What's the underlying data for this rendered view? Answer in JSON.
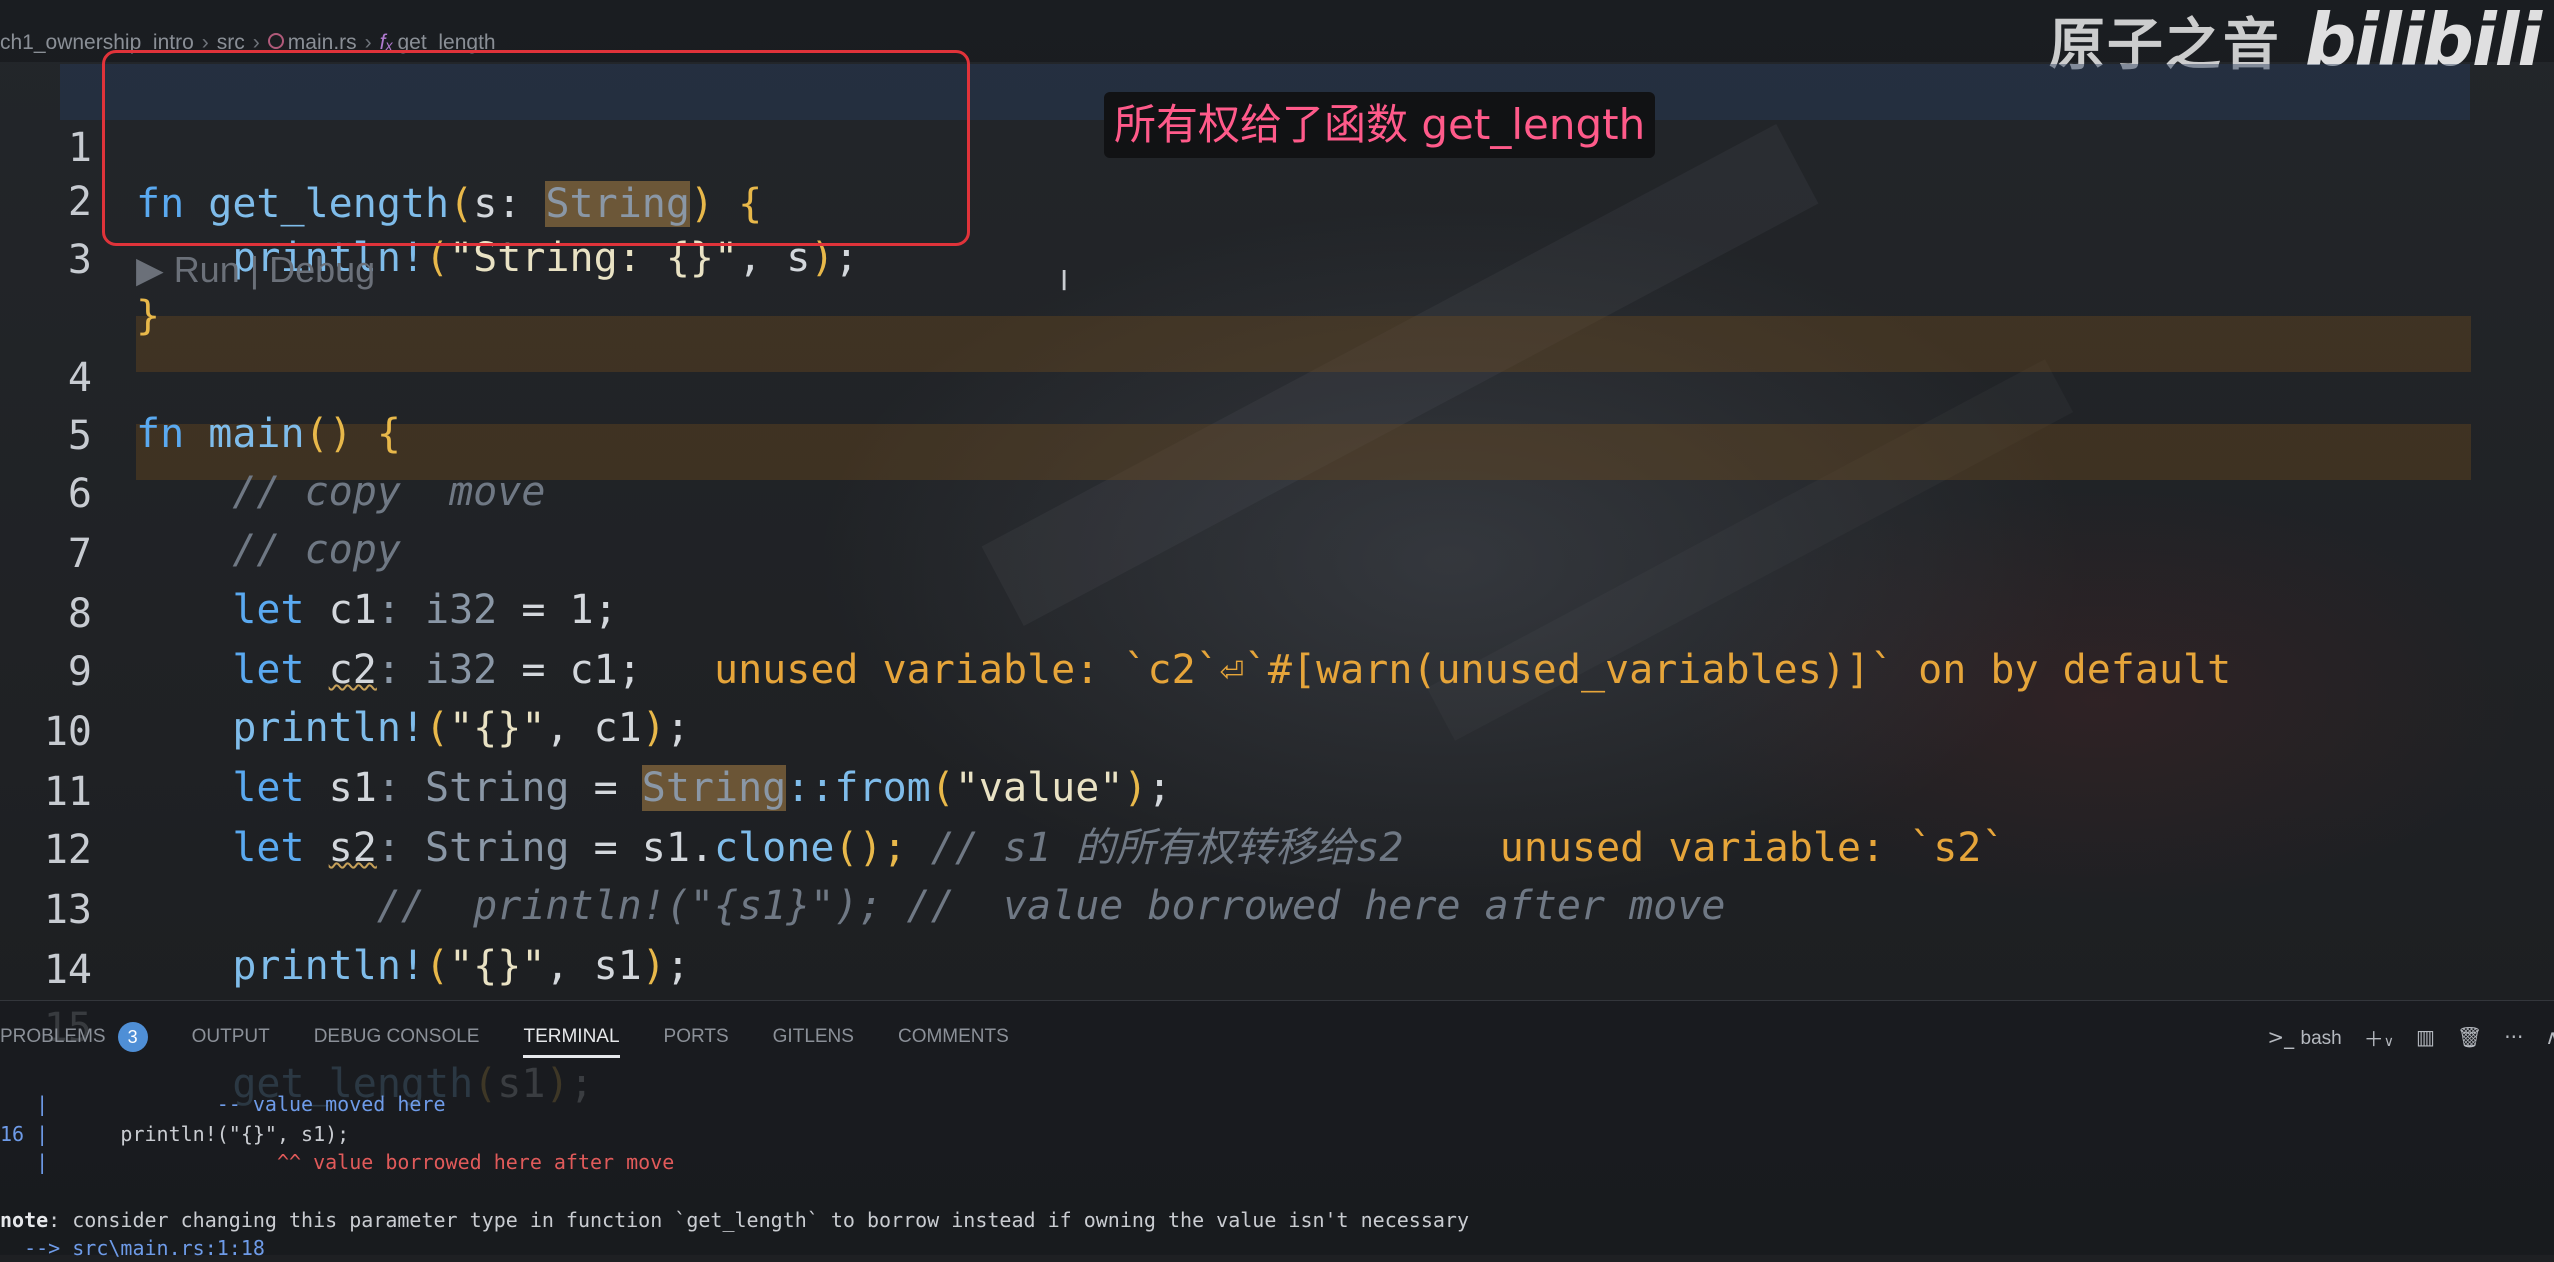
{
  "breadcrumb": {
    "folder": "ch1_ownership_intro",
    "src": "src",
    "file": "main.rs",
    "fn_symbol": "fₓ",
    "symbol": "get_length"
  },
  "watermark": {
    "cn": "原子之音",
    "logo": "bilibili"
  },
  "annotation": "所有权给了函数 get_length",
  "codelens": "▶ Run | Debug",
  "code": {
    "l1": {
      "n": "1",
      "fn": "fn",
      "name": "get_length",
      "param": "s",
      "colon": ": ",
      "type": "String",
      "rest": " {"
    },
    "l2": {
      "n": "2",
      "mac": "println!",
      "str": "\"String: {}\"",
      "rest": ", s",
      "end": ";"
    },
    "l3": {
      "n": "3",
      "text": "}"
    },
    "l4": {
      "n": "4",
      "fn": "fn",
      "name": "main",
      "rest": "() {"
    },
    "l5": {
      "n": "5",
      "text": "// copy  move"
    },
    "l6": {
      "n": "6",
      "text": "// copy"
    },
    "l7": {
      "n": "7",
      "kw": "let",
      "var": "c1",
      "hint": ": i32",
      "rest": " = 1;"
    },
    "l8": {
      "n": "8",
      "kw": "let",
      "var": "c2",
      "hint": ": i32",
      "rest": " = c1;",
      "warn": "unused variable: `c2`⏎`#[warn(unused_variables)]` on by default"
    },
    "l9": {
      "n": "9",
      "mac": "println!",
      "str": "\"{}\"",
      "rest": ", c1",
      "end": ";"
    },
    "l10": {
      "n": "10",
      "kw": "let",
      "var": "s1",
      "hint": ": String",
      "eq": " = ",
      "type": "String",
      "call": "::from",
      "str": "\"value\"",
      "end": ";"
    },
    "l11": {
      "n": "11",
      "kw": "let",
      "var": "s2",
      "hint": ": String",
      "rest": " = s1.",
      "method": "clone",
      "end": "();",
      "cmt": " // s1 的所有权转移给s2",
      "warn": "unused variable: `s2`"
    },
    "l12": {
      "n": "12",
      "text": "//  println!(\"{s1}\"); //  value borrowed here after move"
    },
    "l13": {
      "n": "13",
      "mac": "println!",
      "str": "\"{}\"",
      "rest": ", s1",
      "end": ";"
    },
    "l14": {
      "n": "14"
    },
    "l15": {
      "n": "15",
      "name": "get_length",
      "rest": "s1",
      "end": ";"
    }
  },
  "panel": {
    "tabs": [
      "PROBLEMS",
      "OUTPUT",
      "DEBUG CONSOLE",
      "TERMINAL",
      "PORTS",
      "GITLENS",
      "COMMENTS"
    ],
    "problems_count": "3",
    "active_tab": "TERMINAL",
    "terminal_name": "bash",
    "terminal_lines": {
      "t1a": "   |",
      "t1b": "              -- value moved here",
      "t2a": "16 |",
      "t2b": "      println!(\"{}\", s1);",
      "t3a": "   |",
      "t3b": "                   ^^ value borrowed here after move",
      "t4a": "note",
      "t4b": ": consider changing this parameter type in function `get_length` to borrow instead if owning the value isn't necessary",
      "t5": "  --> src\\main.rs:1:18"
    }
  },
  "colors": {
    "accent": "#5aa9f0",
    "warning": "#e6a53a",
    "highlight_box": "#e0333a",
    "annotation": "#ff5a8a"
  }
}
